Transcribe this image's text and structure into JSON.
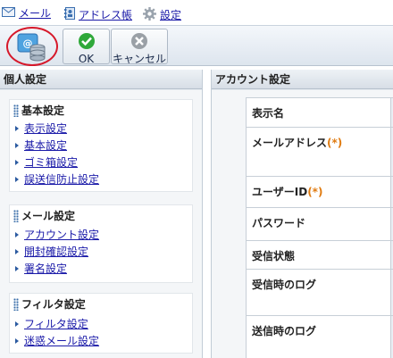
{
  "nav": {
    "mail": "メール",
    "address_book": "アドレス帳",
    "settings": "設定"
  },
  "toolbar": {
    "ok_label": "OK",
    "cancel_label": "キャンセル"
  },
  "left": {
    "header": "個人設定",
    "groups": [
      {
        "title": "基本設定",
        "items": [
          "表示設定",
          "基本設定",
          "ゴミ箱設定",
          "誤送信防止設定"
        ]
      },
      {
        "title": "メール設定",
        "items": [
          "アカウント設定",
          "開封確認設定",
          "署名設定"
        ]
      },
      {
        "title": "フィルタ設定",
        "items": [
          "フィルタ設定",
          "迷惑メール設定"
        ]
      }
    ]
  },
  "right": {
    "header": "アカウント設定",
    "rows": [
      {
        "label": "表示名",
        "required": ""
      },
      {
        "label": "メールアドレス",
        "required": "(*)"
      },
      {
        "label": "ユーザーID",
        "required": "(*)"
      },
      {
        "label": "パスワード",
        "required": ""
      },
      {
        "label": "受信状態",
        "required": ""
      },
      {
        "label": "受信時のログ",
        "required": ""
      },
      {
        "label": "送信時のログ",
        "required": ""
      }
    ]
  },
  "colors": {
    "link": "#1a1aa8",
    "required": "#e07b10",
    "highlight_ring": "#d6182a",
    "ok_green": "#2fa83a",
    "cancel_gray": "#9aa0a6"
  },
  "icons": {
    "mail": "envelope-icon",
    "address_book": "address-book-icon",
    "settings": "gear-icon",
    "account": "account-database-icon",
    "ok": "check-circle-icon",
    "cancel": "x-circle-icon",
    "group": "grip-icon",
    "link": "arrow-right-icon"
  }
}
